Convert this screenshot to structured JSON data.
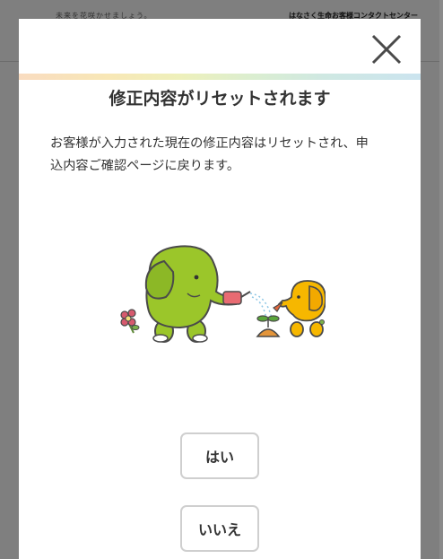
{
  "background": {
    "tagline": "未来を花咲かせましょう。",
    "contact_link": "はなさく生命お客様コンタクトセンター"
  },
  "modal": {
    "title": "修正内容がリセットされます",
    "message_line1": "お客様が入力された現在の修正内容はリセットされ、申",
    "message_line2": "込内容ご確認ページに戻ります。",
    "close_icon": "close-icon",
    "yes_label": "はい",
    "no_label": "いいえ"
  },
  "colors": {
    "overlay": "#7e7e7e",
    "elephant_green": "#9bc62a",
    "elephant_yellow": "#f6b700",
    "button_border": "#cfcfcf"
  }
}
